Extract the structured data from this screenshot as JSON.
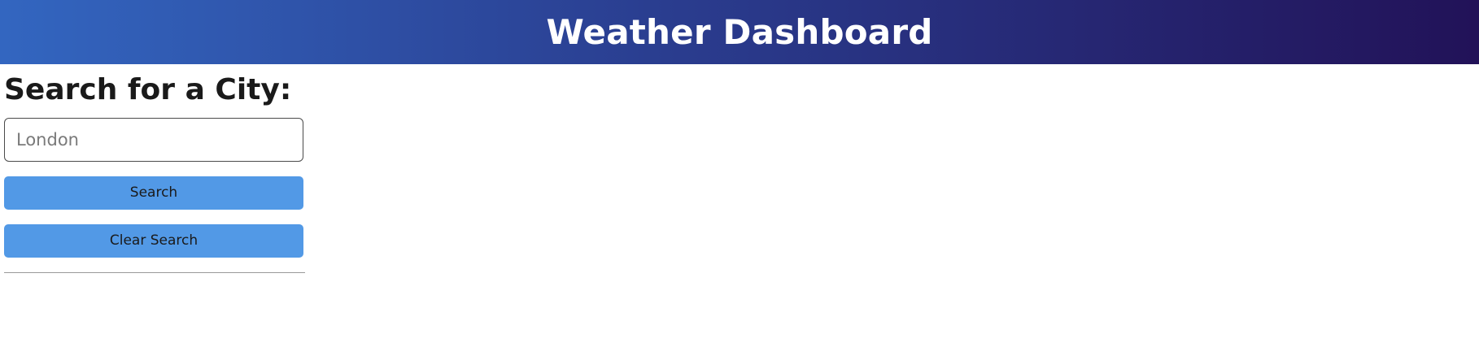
{
  "header": {
    "title": "Weather Dashboard"
  },
  "search_panel": {
    "heading": "Search for a City:",
    "input_placeholder": "London",
    "input_value": "",
    "search_button_label": "Search",
    "clear_button_label": "Clear Search"
  },
  "colors": {
    "header_gradient_start": "#3366c0",
    "header_gradient_end": "#221258",
    "button_background": "#5299e6"
  }
}
